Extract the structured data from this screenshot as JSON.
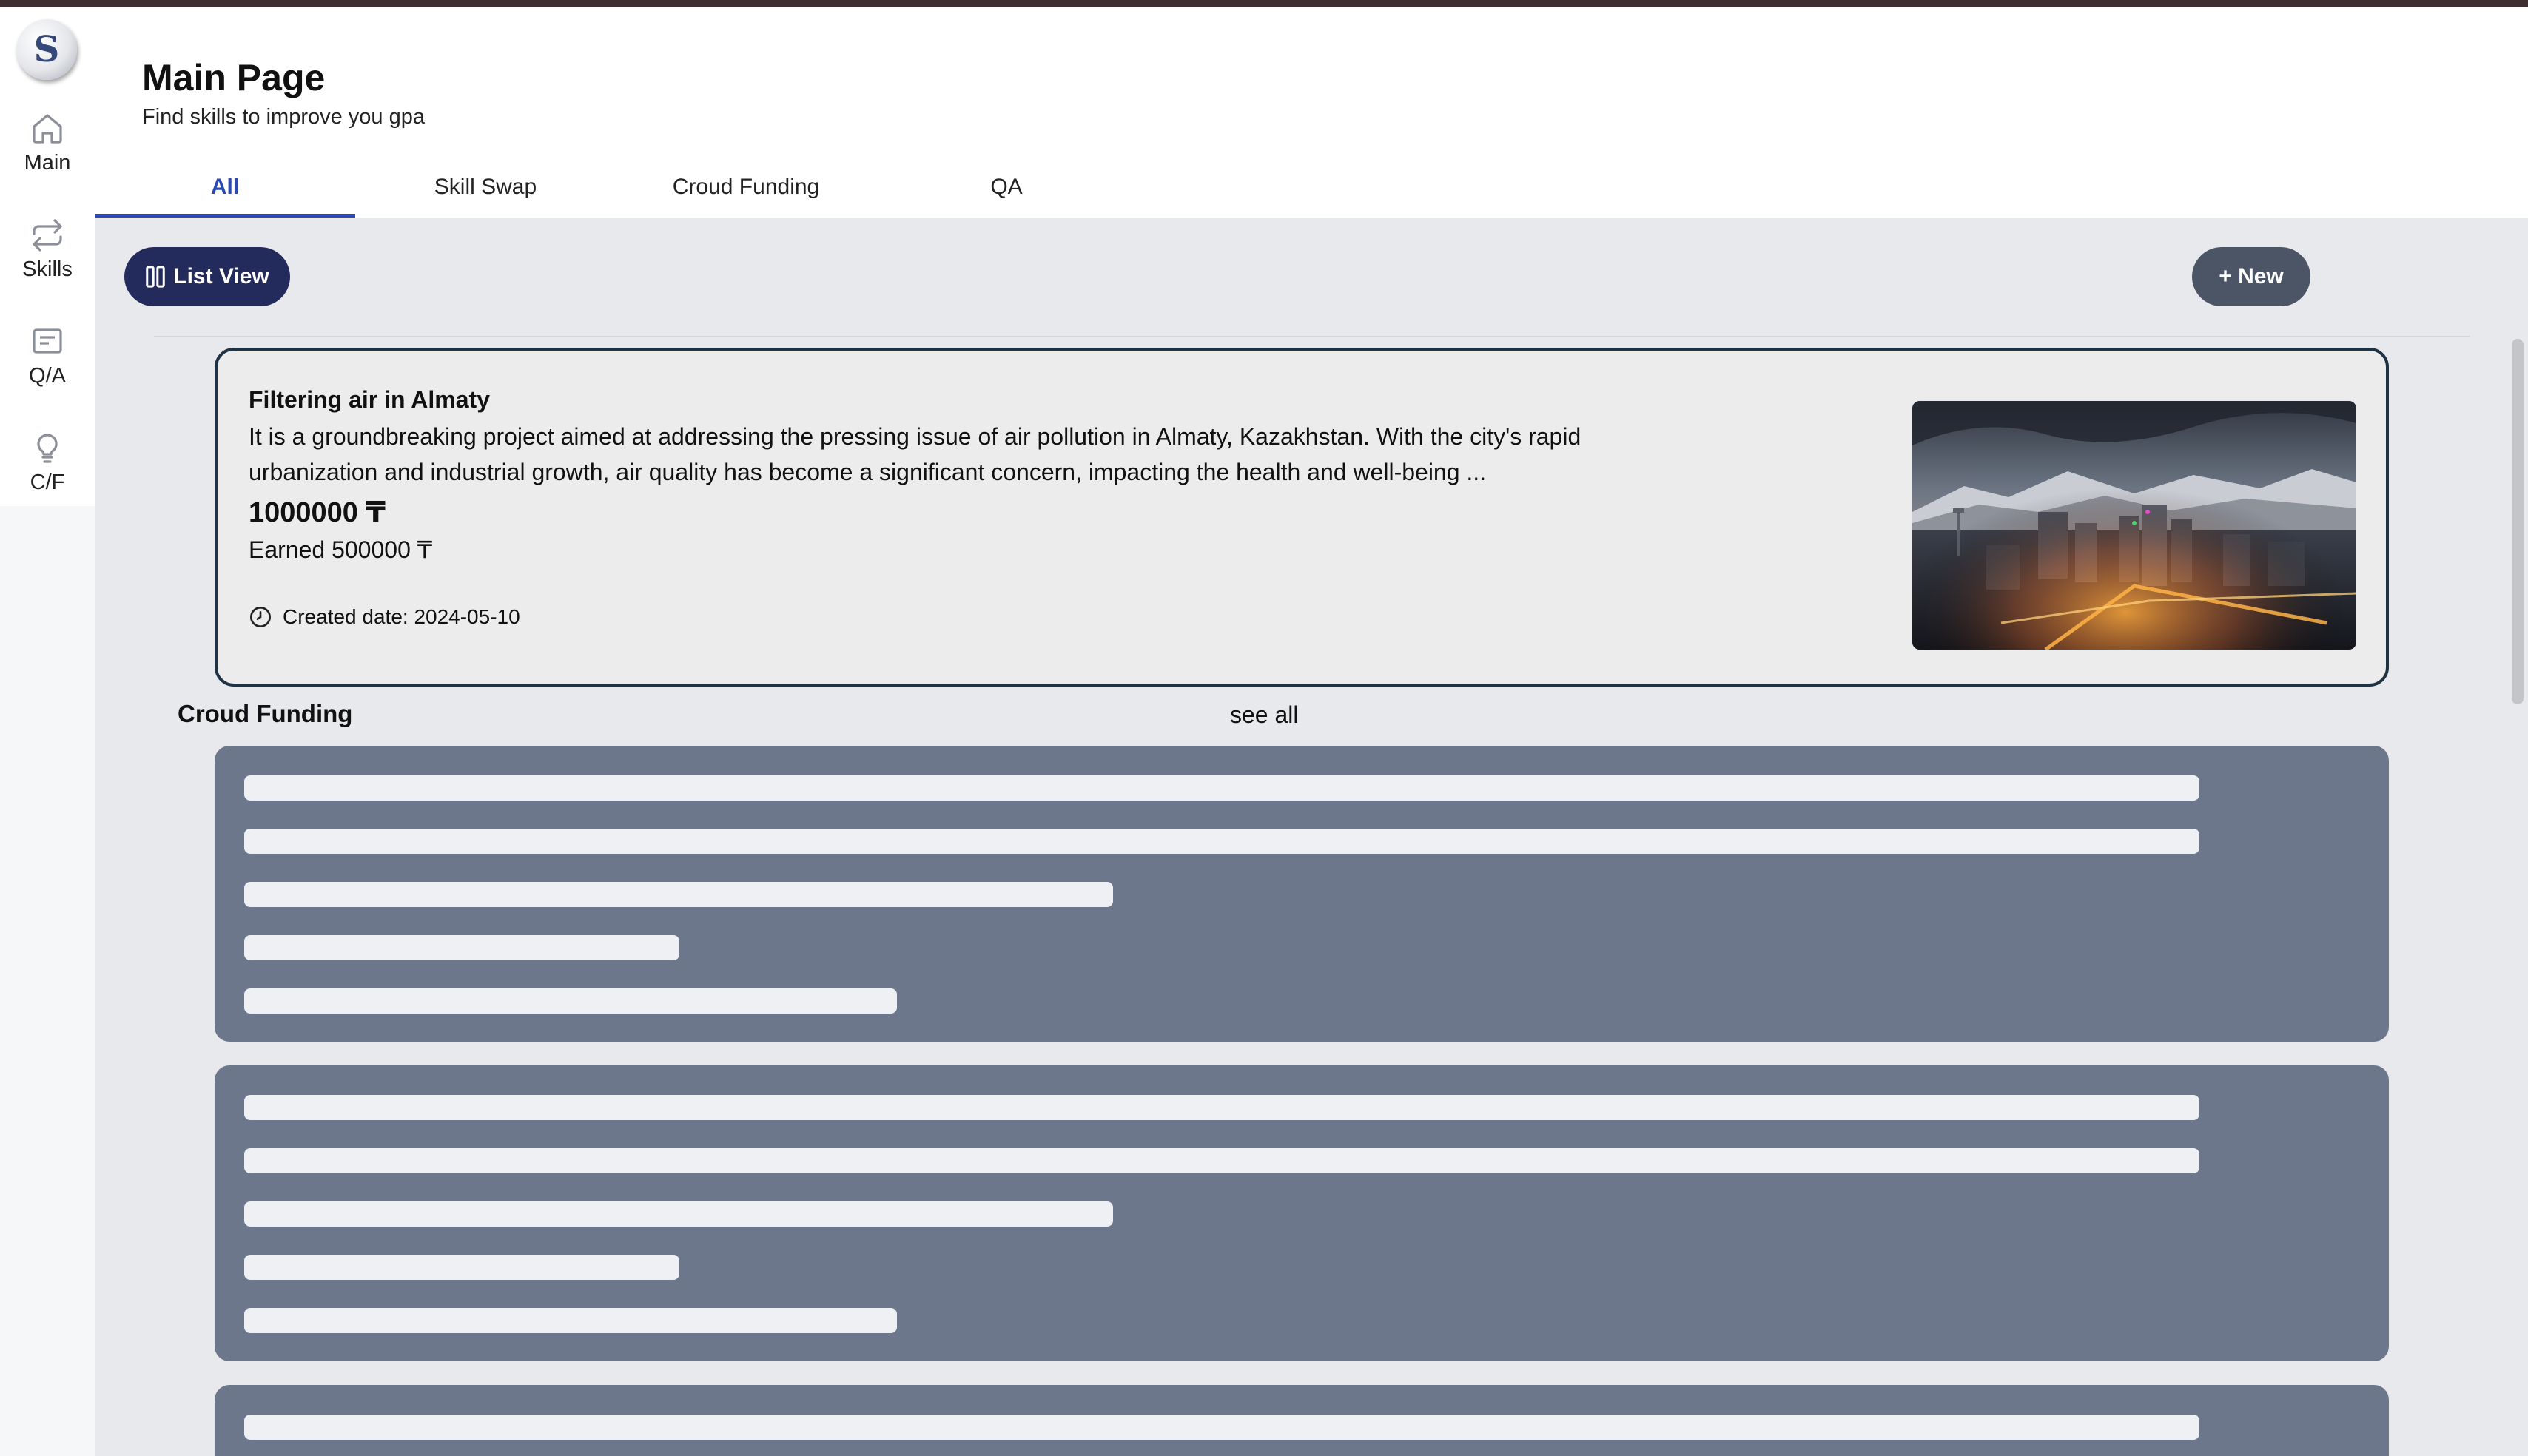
{
  "logo": {
    "letter": "S"
  },
  "sidebar": {
    "items": [
      {
        "label": "Main",
        "icon": "home-icon"
      },
      {
        "label": "Skills",
        "icon": "swap-arrows-icon"
      },
      {
        "label": "Q/A",
        "icon": "message-square-icon"
      },
      {
        "label": "C/F",
        "icon": "lightbulb-icon"
      }
    ]
  },
  "header": {
    "title": "Main Page",
    "subtitle": "Find skills to improve you gpa"
  },
  "tabs": [
    {
      "label": "All",
      "active": true
    },
    {
      "label": "Skill Swap",
      "active": false
    },
    {
      "label": "Croud Funding",
      "active": false
    },
    {
      "label": "QA",
      "active": false
    }
  ],
  "toolbar": {
    "list_view_label": "List View",
    "new_label": "+ New"
  },
  "featured": {
    "title": "Filtering air in Almaty",
    "description": "It is a groundbreaking project aimed at addressing the pressing issue of air pollution in Almaty, Kazakhstan. With the city's rapid urbanization and industrial growth, air quality has become a significant concern, impacting the health and well-being ...",
    "goal": "1000000 ₸",
    "earned": "Earned 500000 ₸",
    "created": "Created date: 2024-05-10",
    "image": "almaty-city-night-photo"
  },
  "section": {
    "title": "Croud Funding",
    "see_all": "see all"
  },
  "colors": {
    "accent": "#2c49b3",
    "list_button": "#232a5c",
    "new_button": "#4b5565",
    "skeleton_card": "#6c778c",
    "card_border": "#1f3344",
    "top_bar": "#3e2f2e"
  }
}
